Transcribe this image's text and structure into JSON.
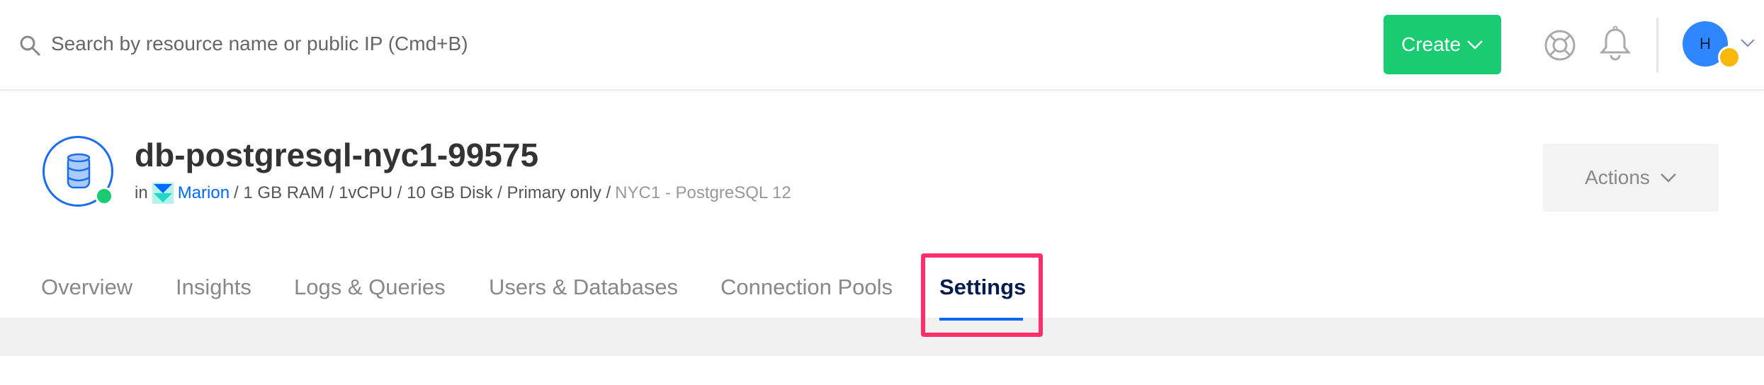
{
  "header": {
    "search_placeholder": "Search by resource name or public IP (Cmd+B)",
    "create_label": "Create",
    "avatar_initial": "H"
  },
  "resource": {
    "name": "db-postgresql-nyc1-99575",
    "in_label": "in",
    "project": "Marion",
    "specs": "/ 1 GB RAM / 1vCPU / 10 GB Disk / Primary only /",
    "region": "NYC1 - PostgreSQL 12",
    "status": "online"
  },
  "actions_label": "Actions",
  "tabs": [
    {
      "label": "Overview"
    },
    {
      "label": "Insights"
    },
    {
      "label": "Logs & Queries"
    },
    {
      "label": "Users & Databases"
    },
    {
      "label": "Connection Pools"
    },
    {
      "label": "Settings",
      "active": true
    }
  ],
  "colors": {
    "primary": "#0069ff",
    "create": "#19cc72",
    "highlight": "#ff2f6a"
  }
}
